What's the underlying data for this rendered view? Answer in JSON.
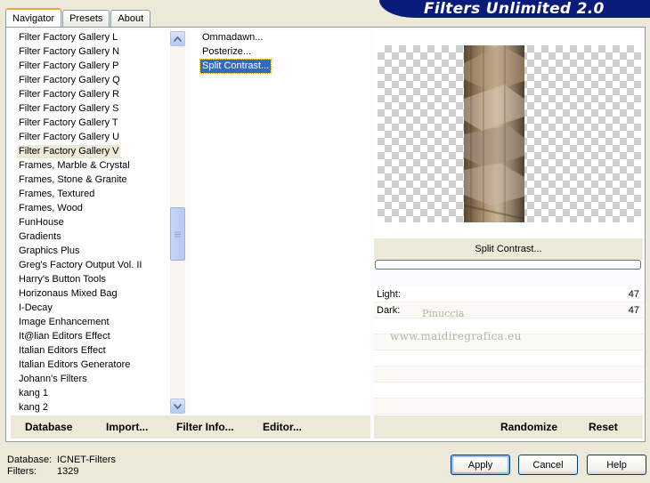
{
  "app": {
    "title": "Filters Unlimited 2.0"
  },
  "tabs": [
    {
      "label": "Navigator",
      "active": true
    },
    {
      "label": "Presets",
      "active": false
    },
    {
      "label": "About",
      "active": false
    }
  ],
  "categories": {
    "items": [
      "Filter Factory Gallery L",
      "Filter Factory Gallery N",
      "Filter Factory Gallery P",
      "Filter Factory Gallery Q",
      "Filter Factory Gallery R",
      "Filter Factory Gallery S",
      "Filter Factory Gallery T",
      "Filter Factory Gallery U",
      "Filter Factory Gallery V",
      "Frames, Marble & Crystal",
      "Frames, Stone & Granite",
      "Frames, Textured",
      "Frames, Wood",
      "FunHouse",
      "Gradients",
      "Graphics Plus",
      "Greg's Factory Output Vol. II",
      "Harry's Button Tools",
      "Horizonaus Mixed Bag",
      "I-Decay",
      "Image Enhancement",
      "It@lian Editors Effect",
      "Italian Editors Effect",
      "Italian Editors Generatore",
      "Johann's Filters",
      "kang 1",
      "kang 2"
    ],
    "selected_index": 8
  },
  "filters": {
    "items": [
      "Ommadawn...",
      "Posterize...",
      "Split Contrast..."
    ],
    "selected_index": 2
  },
  "preview": {
    "filter_name": "Split Contrast...",
    "progress": 0
  },
  "sliders": [
    {
      "label": "Light:",
      "value": "47"
    },
    {
      "label": "Dark:",
      "value": "47"
    }
  ],
  "watermark": {
    "line1": "Pinuccia",
    "line2": "www.maidiregrafica.eu"
  },
  "toolbar": {
    "database": "Database",
    "import": "Import...",
    "filter_info": "Filter Info...",
    "editor": "Editor...",
    "randomize": "Randomize",
    "reset": "Reset"
  },
  "footer": {
    "database_label": "Database:",
    "database_value": "ICNET-Filters",
    "filters_label": "Filters:",
    "filters_value": "1329",
    "apply": "Apply",
    "cancel": "Cancel",
    "help": "Help"
  }
}
